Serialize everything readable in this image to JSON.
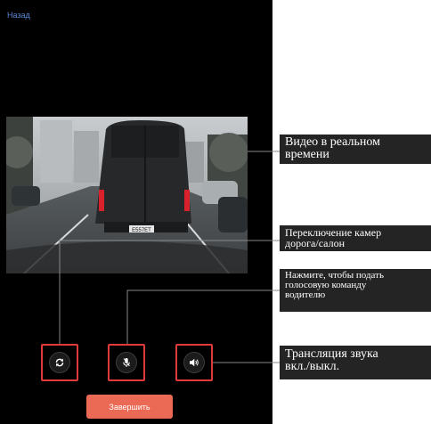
{
  "header": {
    "back_label": "Назад"
  },
  "video": {
    "license_plate": "Е557ЕТ"
  },
  "controls": {
    "switch_camera_icon": "rotate-camera-icon",
    "voice_command_icon": "microphone-icon",
    "audio_toggle_icon": "speaker-icon"
  },
  "finish_button": {
    "label": "Завершить"
  },
  "annotations": {
    "live_video": "Видео в реальном\nвремени",
    "camera_switch": "Переключение камер\nдорога/салон",
    "voice_command": "Нажмите, чтобы подать\nголосовую команду\nводителю",
    "audio_toggle": "Трансляция звука\nвкл./выкл."
  },
  "colors": {
    "highlight": "#e03a3a",
    "finish_button": "#ea6a55",
    "link": "#5a87d6"
  }
}
